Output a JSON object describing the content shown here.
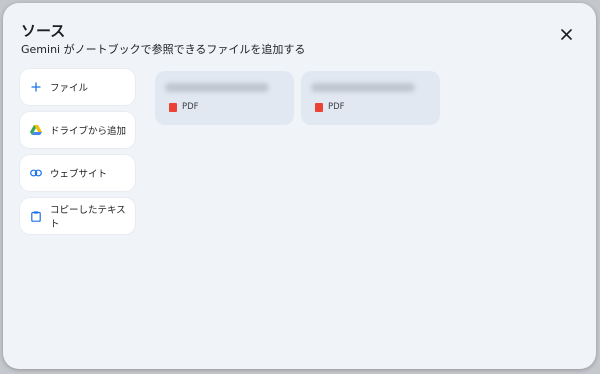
{
  "dialog": {
    "title": "ソース",
    "subtitle": "Gemini がノートブックで参照できるファイルを追加する",
    "close_label": "✕"
  },
  "sidebar": {
    "items": [
      {
        "label": "ファイル",
        "icon": "plus-icon"
      },
      {
        "label": "ドライブから追加",
        "icon": "google-drive-icon"
      },
      {
        "label": "ウェブサイト",
        "icon": "link-icon"
      },
      {
        "label": "コピーしたテキスト",
        "icon": "clipboard-icon"
      }
    ]
  },
  "sources": [
    {
      "type_label": "PDF",
      "name_visible": false
    },
    {
      "type_label": "PDF",
      "name_visible": false
    }
  ],
  "colors": {
    "dialog_bg": "#f0f4f9",
    "card_bg": "#e2e8f1",
    "pdf_red": "#ea4335",
    "link_blue": "#1a73e8"
  }
}
